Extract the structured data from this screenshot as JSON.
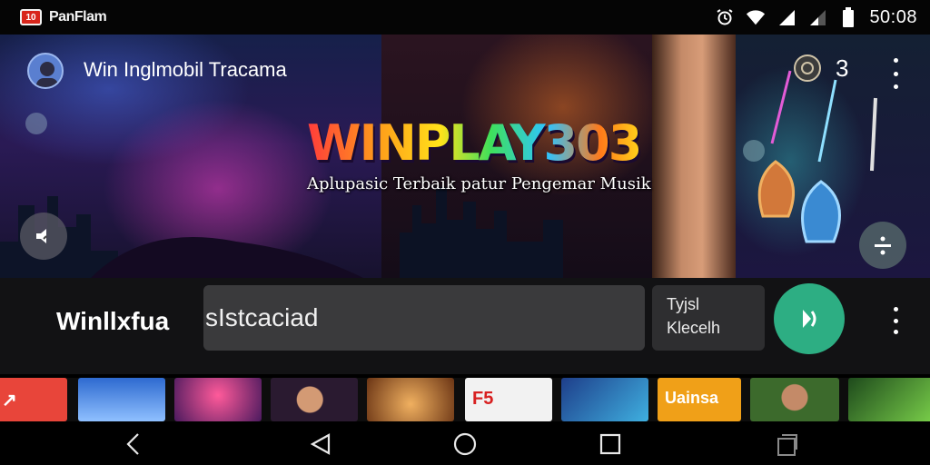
{
  "status_bar": {
    "badge_text": "10",
    "app_name": "PanFlam",
    "time": "50:08",
    "icons": [
      "alarm-icon",
      "wifi-icon",
      "signal-icon",
      "signal-weak-icon",
      "battery-icon"
    ]
  },
  "hero": {
    "title": "Win Inglmobil Tracama",
    "count": "3",
    "brand": "WINPLAY303",
    "tagline": "Aplupasic Terbaik patur Pengemar Musik"
  },
  "search_row": {
    "label": "Winllxfua",
    "search_value": "sIstcaciad",
    "card_line1": "Tyjsl",
    "card_line2": "Klecelh"
  },
  "thumbnails": [
    {
      "id": "t1",
      "text": "↗",
      "bg": "#e8453a"
    },
    {
      "id": "t2",
      "text": "",
      "bg": "#3e7cc8"
    },
    {
      "id": "t3",
      "text": "",
      "bg": "#6c2a6e"
    },
    {
      "id": "t4",
      "text": "",
      "bg": "#2a1a30"
    },
    {
      "id": "t5",
      "text": "",
      "bg": "#8a4a1c"
    },
    {
      "id": "t6",
      "text": "F5",
      "bg": "#f2f2f2"
    },
    {
      "id": "t7",
      "text": "",
      "bg": "#1e3e8a"
    },
    {
      "id": "t8",
      "text": "Uainsa",
      "bg": "#f0a018"
    },
    {
      "id": "t9",
      "text": "",
      "bg": "#3c6a2c"
    },
    {
      "id": "t10",
      "text": "",
      "bg": "#1e4a1c"
    }
  ],
  "nav_bar": {
    "icons": [
      "back-chevron-icon",
      "back-triangle-icon",
      "home-circle-icon",
      "overview-square-icon",
      "recents-stack-icon"
    ]
  },
  "colors": {
    "accent_green": "#2dae83",
    "search_bg": "#3a3a3c",
    "row_bg": "#121214"
  }
}
